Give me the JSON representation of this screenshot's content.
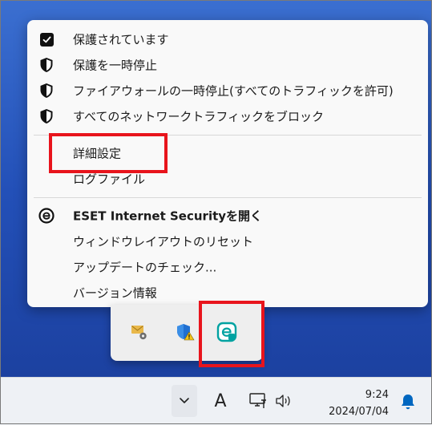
{
  "menu": {
    "items": [
      {
        "label": "保護されています",
        "icon": "checkbox-checked-icon"
      },
      {
        "label": "保護を一時停止",
        "icon": "shield-icon"
      },
      {
        "label": "ファイアウォールの一時停止(すべてのトラフィックを許可)",
        "icon": "shield-icon"
      },
      {
        "label": "すべてのネットワークトラフィックをブロック",
        "icon": "shield-icon"
      },
      {
        "label": "詳細設定",
        "icon": ""
      },
      {
        "label": "ログファイル",
        "icon": ""
      },
      {
        "label": "ESET Internet Securityを開く",
        "icon": "eset-logo-icon"
      },
      {
        "label": "ウィンドウレイアウトのリセット",
        "icon": ""
      },
      {
        "label": "アップデートのチェック...",
        "icon": ""
      },
      {
        "label": "バージョン情報",
        "icon": ""
      }
    ]
  },
  "tray": {
    "icons": [
      "mail-settings-icon",
      "defender-warning-icon",
      "eset-tray-icon"
    ]
  },
  "taskbar": {
    "chevron": "^",
    "ime": "A",
    "time": "9:24",
    "date": "2024/07/04"
  },
  "colors": {
    "highlight": "#e8141c",
    "accent": "#0067c0",
    "eset": "#00a2a1"
  }
}
